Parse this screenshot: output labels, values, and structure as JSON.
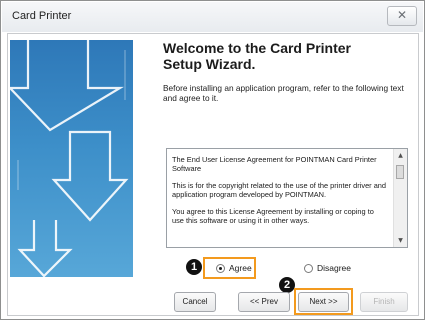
{
  "window": {
    "title": "Card Printer",
    "close_glyph": "✕"
  },
  "banner": {
    "icon": "down-arrow-icon",
    "colors": {
      "top": "#2e78b8",
      "bottom": "#57a7d8",
      "arrow_stroke": "#ffffff"
    }
  },
  "header": {
    "title": "Welcome to the Card Printer Setup Wizard."
  },
  "instructions": "Before installing an application program, refer to the following text and agree to it.",
  "license": {
    "paragraphs": [
      "The End User License Agreement for POINTMAN Card Printer Software",
      "This is for the copyright related to the use of the printer driver and application program developed by POINTMAN.",
      "You agree to this License Agreement by installing or coping to use this software or using it in other ways."
    ],
    "scroll_up_glyph": "▲",
    "scroll_down_glyph": "▼"
  },
  "markers": {
    "one": "1",
    "two": "2"
  },
  "options": {
    "agree": "Agree",
    "disagree": "Disagree",
    "selected": "Agree"
  },
  "buttons": {
    "cancel": "Cancel",
    "prev": "<< Prev",
    "next": "Next >>",
    "finish": "Finish"
  },
  "colors": {
    "highlight": "#f39a1e"
  }
}
